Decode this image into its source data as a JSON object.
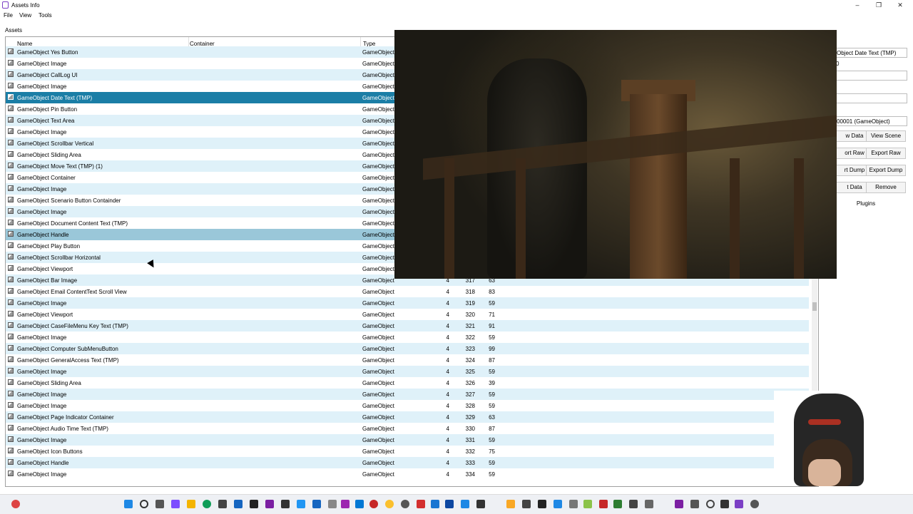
{
  "window": {
    "title": "Assets Info"
  },
  "menu": [
    "File",
    "View",
    "Tools"
  ],
  "assets_label": "Assets",
  "columns": {
    "name": "Name",
    "container": "Container",
    "type": "Type"
  },
  "rows": [
    {
      "name": "GameObject Yes Button",
      "type": "GameObject",
      "c1": "",
      "c2": "",
      "c3": ""
    },
    {
      "name": "GameObject Image",
      "type": "GameObject",
      "c1": "",
      "c2": "",
      "c3": ""
    },
    {
      "name": "GameObject CallLog UI",
      "type": "GameObject",
      "c1": "",
      "c2": "",
      "c3": ""
    },
    {
      "name": "GameObject Image",
      "type": "GameObject",
      "c1": "",
      "c2": "",
      "c3": ""
    },
    {
      "name": "GameObject Date Text (TMP)",
      "type": "GameObject",
      "c1": "",
      "c2": "",
      "c3": "",
      "state": "selected"
    },
    {
      "name": "GameObject Pin Button",
      "type": "GameObject",
      "c1": "",
      "c2": "",
      "c3": ""
    },
    {
      "name": "GameObject Text Area",
      "type": "GameObject",
      "c1": "",
      "c2": "",
      "c3": ""
    },
    {
      "name": "GameObject Image",
      "type": "GameObject",
      "c1": "",
      "c2": "",
      "c3": ""
    },
    {
      "name": "GameObject Scrollbar Vertical",
      "type": "GameObject",
      "c1": "",
      "c2": "",
      "c3": ""
    },
    {
      "name": "GameObject Sliding Area",
      "type": "GameObject",
      "c1": "",
      "c2": "",
      "c3": ""
    },
    {
      "name": "GameObject Move Text (TMP) (1)",
      "type": "GameObject",
      "c1": "",
      "c2": "",
      "c3": ""
    },
    {
      "name": "GameObject Container",
      "type": "GameObject",
      "c1": "",
      "c2": "",
      "c3": ""
    },
    {
      "name": "GameObject Image",
      "type": "GameObject",
      "c1": "",
      "c2": "",
      "c3": ""
    },
    {
      "name": "GameObject Scenario Button Containder",
      "type": "GameObject",
      "c1": "",
      "c2": "",
      "c3": ""
    },
    {
      "name": "GameObject Image",
      "type": "GameObject",
      "c1": "",
      "c2": "",
      "c3": ""
    },
    {
      "name": "GameObject Document Content Text (TMP)",
      "type": "GameObject",
      "c1": "",
      "c2": "",
      "c3": ""
    },
    {
      "name": "GameObject Handle",
      "type": "GameObject",
      "c1": "",
      "c2": "",
      "c3": "",
      "state": "hover"
    },
    {
      "name": "GameObject Play Button",
      "type": "GameObject",
      "c1": "",
      "c2": "",
      "c3": ""
    },
    {
      "name": "GameObject Scrollbar Horizontal",
      "type": "GameObject",
      "c1": "",
      "c2": "",
      "c3": ""
    },
    {
      "name": "GameObject Viewport",
      "type": "GameObject",
      "c1": "",
      "c2": "",
      "c3": ""
    },
    {
      "name": "GameObject Bar Image",
      "type": "GameObject",
      "c1": "4",
      "c2": "317",
      "c3": "63"
    },
    {
      "name": "GameObject Email ContentText Scroll View",
      "type": "GameObject",
      "c1": "4",
      "c2": "318",
      "c3": "83"
    },
    {
      "name": "GameObject Image",
      "type": "GameObject",
      "c1": "4",
      "c2": "319",
      "c3": "59"
    },
    {
      "name": "GameObject Viewport",
      "type": "GameObject",
      "c1": "4",
      "c2": "320",
      "c3": "71"
    },
    {
      "name": "GameObject CaseFileMenu Key Text (TMP)",
      "type": "GameObject",
      "c1": "4",
      "c2": "321",
      "c3": "91"
    },
    {
      "name": "GameObject Image",
      "type": "GameObject",
      "c1": "4",
      "c2": "322",
      "c3": "59"
    },
    {
      "name": "GameObject Computer SubMenuButton",
      "type": "GameObject",
      "c1": "4",
      "c2": "323",
      "c3": "99"
    },
    {
      "name": "GameObject GeneralAccess Text (TMP)",
      "type": "GameObject",
      "c1": "4",
      "c2": "324",
      "c3": "87"
    },
    {
      "name": "GameObject Image",
      "type": "GameObject",
      "c1": "4",
      "c2": "325",
      "c3": "59"
    },
    {
      "name": "GameObject Sliding Area",
      "type": "GameObject",
      "c1": "4",
      "c2": "326",
      "c3": "39"
    },
    {
      "name": "GameObject Image",
      "type": "GameObject",
      "c1": "4",
      "c2": "327",
      "c3": "59"
    },
    {
      "name": "GameObject Image",
      "type": "GameObject",
      "c1": "4",
      "c2": "328",
      "c3": "59"
    },
    {
      "name": "GameObject Page Indicator Container",
      "type": "GameObject",
      "c1": "4",
      "c2": "329",
      "c3": "63"
    },
    {
      "name": "GameObject Audio Time Text (TMP)",
      "type": "GameObject",
      "c1": "4",
      "c2": "330",
      "c3": "87"
    },
    {
      "name": "GameObject Image",
      "type": "GameObject",
      "c1": "4",
      "c2": "331",
      "c3": "59"
    },
    {
      "name": "GameObject Icon Buttons",
      "type": "GameObject",
      "c1": "4",
      "c2": "332",
      "c3": "75"
    },
    {
      "name": "GameObject Handle",
      "type": "GameObject",
      "c1": "4",
      "c2": "333",
      "c3": "59"
    },
    {
      "name": "GameObject Image",
      "type": "GameObject",
      "c1": "4",
      "c2": "334",
      "c3": "59"
    }
  ],
  "right_panel": {
    "selected_name": "Object Date Text (TMP)",
    "field2": "0",
    "field3": "",
    "field4": "",
    "path_id": "00001 (GameObject)",
    "view_data": "w Data",
    "view_scene": "View Scene",
    "export_raw_left": "ort Raw",
    "export_raw": "Export Raw",
    "export_dump_left": "rt Dump",
    "export_dump": "Export Dump",
    "edit_data": "t Data",
    "remove": "Remove",
    "plugins": "Plugins"
  },
  "colors": {
    "selected_row": "#1b7ea6",
    "hover_row": "#9ac7d9",
    "alt_row": "#dff1f9"
  }
}
